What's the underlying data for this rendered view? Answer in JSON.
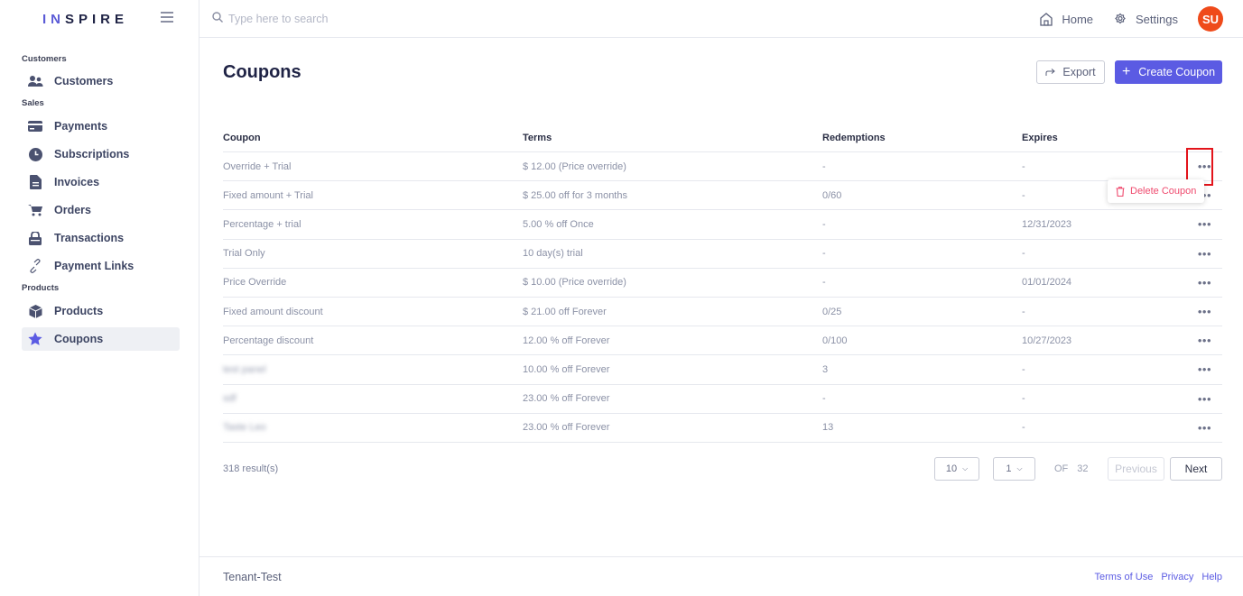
{
  "brand": {
    "name_part1": "IN",
    "name_part2": "SPIRE"
  },
  "search": {
    "placeholder": "Type here to search"
  },
  "topnav": {
    "home_label": "Home",
    "settings_label": "Settings",
    "avatar_initials": "SU",
    "avatar_color": "#ef4a1a"
  },
  "sidebar": {
    "sections": {
      "customers": "Customers",
      "sales": "Sales",
      "products": "Products"
    },
    "items": {
      "customers": "Customers",
      "payments": "Payments",
      "subscriptions": "Subscriptions",
      "invoices": "Invoices",
      "orders": "Orders",
      "transactions": "Transactions",
      "payment_links": "Payment Links",
      "products": "Products",
      "coupons": "Coupons"
    },
    "active_item": "coupons"
  },
  "page": {
    "title": "Coupons",
    "export_label": "Export",
    "create_label": "Create Coupon",
    "accent_color": "#5b5be3"
  },
  "table": {
    "headers": {
      "coupon": "Coupon",
      "terms": "Terms",
      "redemptions": "Redemptions",
      "expires": "Expires"
    },
    "rows": [
      {
        "coupon": "Override + Trial",
        "terms": "$ 12.00 (Price override)",
        "redemptions": "-",
        "expires": "-"
      },
      {
        "coupon": "Fixed amount + Trial",
        "terms": "$ 25.00 off for 3 months",
        "redemptions": "0/60",
        "expires": "-"
      },
      {
        "coupon": "Percentage + trial",
        "terms": "5.00 % off Once",
        "redemptions": "-",
        "expires": "12/31/2023"
      },
      {
        "coupon": "Trial Only",
        "terms": "10 day(s) trial",
        "redemptions": "-",
        "expires": "-"
      },
      {
        "coupon": "Price Override",
        "terms": "$ 10.00 (Price override)",
        "redemptions": "-",
        "expires": "01/01/2024"
      },
      {
        "coupon": "Fixed amount discount",
        "terms": "$ 21.00 off Forever",
        "redemptions": "0/25",
        "expires": "-"
      },
      {
        "coupon": "Percentage discount",
        "terms": "12.00 % off Forever",
        "redemptions": "0/100",
        "expires": "10/27/2023"
      },
      {
        "coupon": "test panel",
        "terms": "10.00 % off Forever",
        "redemptions": "3",
        "expires": "-"
      },
      {
        "coupon": "sdf",
        "terms": "23.00 % off Forever",
        "redemptions": "-",
        "expires": "-"
      },
      {
        "coupon": "Taste Leo",
        "terms": "23.00 % off Forever",
        "redemptions": "13",
        "expires": "-"
      }
    ],
    "row_menu": "•••"
  },
  "context_menu": {
    "delete_label": "Delete Coupon",
    "color": "#ef4a6e"
  },
  "pagination": {
    "result_count": "318 result(s)",
    "page_size": "10",
    "current_page": "1",
    "of_label": "OF",
    "total_pages": "32",
    "previous_label": "Previous",
    "next_label": "Next"
  },
  "footer": {
    "tenant": "Tenant-Test",
    "terms": "Terms of Use",
    "privacy": "Privacy",
    "help": "Help"
  }
}
